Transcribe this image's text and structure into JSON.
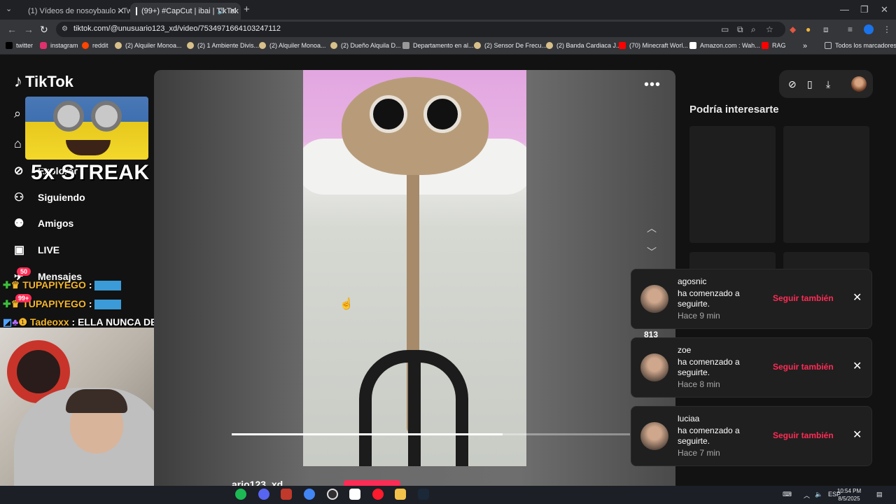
{
  "browser": {
    "tabs": [
      {
        "label": "(1) Vídeos de nosoybaulo - Twit",
        "favicon_color": "#9146ff"
      },
      {
        "label": "(99+) #CapCut | ibai | TikTok",
        "favicon_color": "#ffffff"
      }
    ],
    "new_tab": "+",
    "url": "tiktok.com/@unusuario123_xd/video/7534971664103247112",
    "bookmarks": [
      "twitter",
      "instagram",
      "reddit",
      "(2) Alquiler Monoa...",
      "(2) 1 Ambiente Divis...",
      "(2) Alquiler Monoa...",
      "(2) Dueño Alquila D...",
      "Departamento en al...",
      "(2) Sensor De Frecu...",
      "(2) Banda Cardiaca J...",
      "(70) Minecraft Worl...",
      "Amazon.com : Wah...",
      "RAG"
    ],
    "bookmarks_more": "»",
    "all_bookmarks": "Todos los marcadores"
  },
  "tiktok": {
    "logo": "TikTok",
    "nav": {
      "explorar": "Explorar",
      "siguiendo": "Siguiendo",
      "amigos": "Amigos",
      "live": "LIVE",
      "mensajes": "Mensajes"
    },
    "badge_messages": "50",
    "badge_other": "99+",
    "suggest_title": "Podría interesarte",
    "more": "•••",
    "count": "813",
    "username": "ario123_xd",
    "progress_fraction": 0.68
  },
  "overlay": {
    "streak": "5x STREAK",
    "chat": [
      {
        "user": "TUPAPIYEGO",
        "sep": " : ",
        "color": "#f5b62c"
      },
      {
        "user": "TUPAPIYEGO",
        "sep": " : ",
        "color": "#f5b62c"
      },
      {
        "user": "Tadeoxx",
        "sep": " : ",
        "text": "ELLA NUNCA DEJO DE CREER",
        "color": "#f5b62c"
      }
    ]
  },
  "notifications": [
    {
      "name": "agosnic",
      "message": "ha comenzado a seguirte.",
      "time": "Hace 9 min",
      "action": "Seguir también"
    },
    {
      "name": "zoe",
      "message": "ha comenzado a seguirte.",
      "time": "Hace 8 min",
      "action": "Seguir también"
    },
    {
      "name": "luciaa",
      "message": "ha comenzado a seguirte.",
      "time": "Hace 7 min",
      "action": "Seguir también"
    }
  ],
  "taskbar": {
    "lang": "ESP",
    "time": "10:54 PM",
    "date": "8/5/2025"
  },
  "colors": {
    "accent": "#fe2c55",
    "background": "#121212"
  }
}
